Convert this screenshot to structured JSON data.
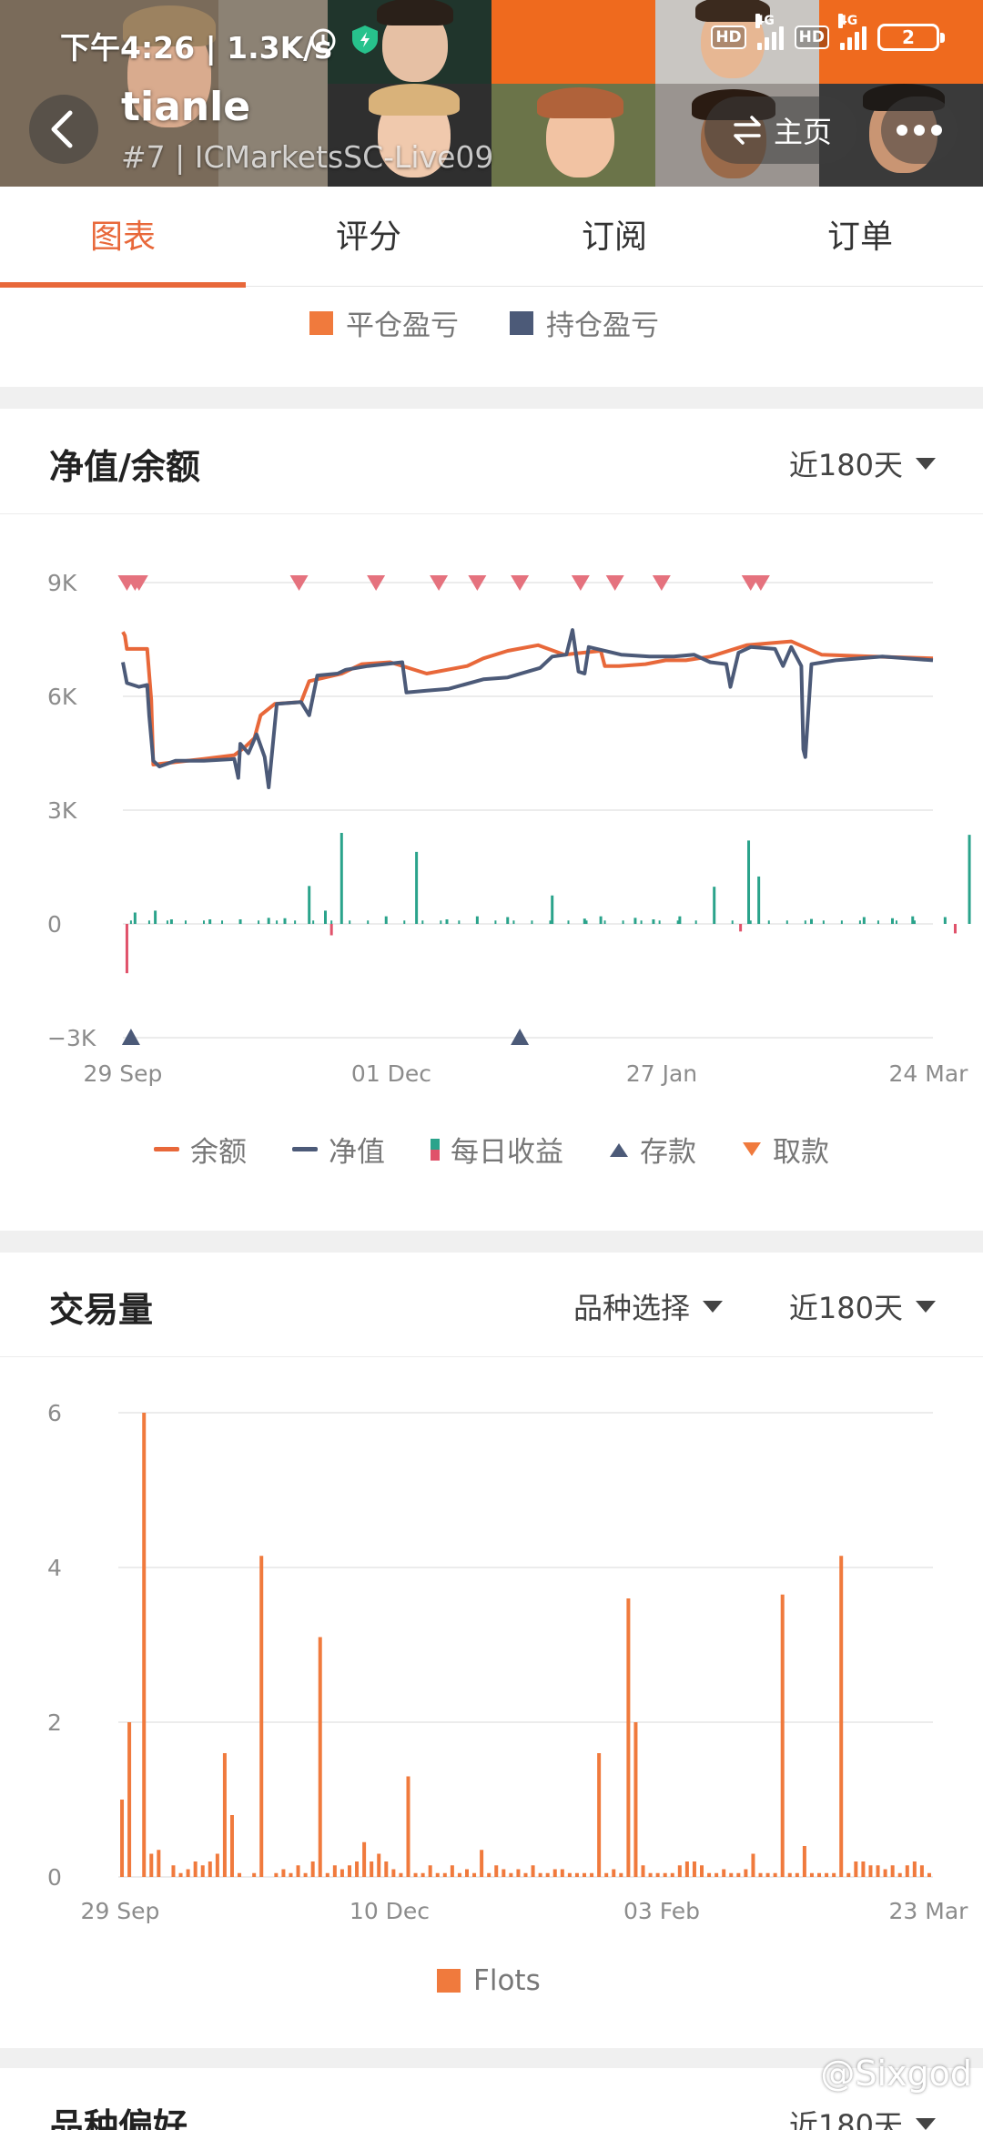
{
  "status_bar": {
    "time_speed": "下午4:26 | 1.3K/s",
    "hd1": "HD",
    "hd2": "HD",
    "net1": "4G",
    "net2": "4G",
    "battery": "2"
  },
  "header": {
    "name": "tianle",
    "subtitle": "#7 | ICMarketsSC-Live09",
    "home_label": "主页"
  },
  "tabs": [
    {
      "label": "图表"
    },
    {
      "label": "评分"
    },
    {
      "label": "订阅"
    },
    {
      "label": "订单"
    }
  ],
  "pnl_legend": {
    "closed": "平仓盈亏",
    "open": "持仓盈亏",
    "closed_color": "#f07a3d",
    "open_color": "#4c5a78"
  },
  "equity_section": {
    "title": "净值/余额",
    "range": "近180天",
    "legend": {
      "balance": "余额",
      "equity": "净值",
      "daily": "每日收益",
      "deposit": "存款",
      "withdraw": "取款"
    },
    "colors": {
      "balance": "#e8683a",
      "equity": "#4c5a78",
      "daily_pos": "#2aa38b",
      "daily_neg": "#e0526a",
      "deposit": "#4c5a78",
      "withdraw": "#e5727e"
    }
  },
  "volume_section": {
    "title": "交易量",
    "filter": "品种选择",
    "range": "近180天",
    "legend": "Flots",
    "color": "#f07a3d"
  },
  "next_section": {
    "title": "品种偏好",
    "range": "近180天"
  },
  "watermark": "@Sixgod",
  "chart_data": [
    {
      "type": "line",
      "title": "净值/余额",
      "x_ticks": [
        "29 Sep",
        "01 Dec",
        "27 Jan",
        "24 Mar"
      ],
      "y_ticks": [
        "9K",
        "6K",
        "3K",
        "0",
        "−3K"
      ],
      "ylim": [
        -3000,
        9000
      ],
      "x_days": 176,
      "series": [
        {
          "name": "余额",
          "points": [
            [
              0,
              7700
            ],
            [
              1,
              7600
            ],
            [
              2,
              7250
            ],
            [
              12,
              7250
            ],
            [
              14,
              5900
            ],
            [
              15,
              4200
            ],
            [
              40,
              4350
            ],
            [
              55,
              4450
            ],
            [
              60,
              4650
            ],
            [
              65,
              4900
            ],
            [
              68,
              5500
            ],
            [
              75,
              5800
            ],
            [
              88,
              5850
            ],
            [
              92,
              6400
            ],
            [
              108,
              6600
            ],
            [
              118,
              6850
            ],
            [
              132,
              6900
            ],
            [
              150,
              6600
            ],
            [
              170,
              6800
            ],
            [
              178,
              7000
            ],
            [
              190,
              7200
            ],
            [
              205,
              7350
            ],
            [
              218,
              7100
            ],
            [
              236,
              7200
            ],
            [
              238,
              6800
            ],
            [
              245,
              6800
            ],
            [
              258,
              6850
            ],
            [
              268,
              6950
            ],
            [
              278,
              6950
            ],
            [
              290,
              7050
            ],
            [
              308,
              7350
            ],
            [
              330,
              7450
            ],
            [
              345,
              7100
            ],
            [
              370,
              7050
            ],
            [
              400,
              7000
            ]
          ]
        },
        {
          "name": "净值",
          "points": [
            [
              0,
              6900
            ],
            [
              2,
              6350
            ],
            [
              8,
              6250
            ],
            [
              12,
              6300
            ],
            [
              13,
              5500
            ],
            [
              15,
              4300
            ],
            [
              18,
              4150
            ],
            [
              26,
              4300
            ],
            [
              40,
              4300
            ],
            [
              55,
              4350
            ],
            [
              57,
              3850
            ],
            [
              58,
              4750
            ],
            [
              62,
              4500
            ],
            [
              66,
              5000
            ],
            [
              70,
              4400
            ],
            [
              72,
              3600
            ],
            [
              76,
              5800
            ],
            [
              88,
              5850
            ],
            [
              92,
              5500
            ],
            [
              96,
              6550
            ],
            [
              106,
              6600
            ],
            [
              110,
              6700
            ],
            [
              121,
              6800
            ],
            [
              138,
              6900
            ],
            [
              140,
              6100
            ],
            [
              150,
              6150
            ],
            [
              161,
              6200
            ],
            [
              178,
              6450
            ],
            [
              190,
              6500
            ],
            [
              206,
              6750
            ],
            [
              212,
              7050
            ],
            [
              219,
              7100
            ],
            [
              222,
              7750
            ],
            [
              225,
              6650
            ],
            [
              228,
              6600
            ],
            [
              230,
              7300
            ],
            [
              246,
              7100
            ],
            [
              260,
              7050
            ],
            [
              272,
              7050
            ],
            [
              282,
              7100
            ],
            [
              290,
              6900
            ],
            [
              298,
              6850
            ],
            [
              300,
              6250
            ],
            [
              304,
              7150
            ],
            [
              310,
              7300
            ],
            [
              322,
              7250
            ],
            [
              326,
              6800
            ],
            [
              330,
              7300
            ],
            [
              335,
              6800
            ],
            [
              336,
              4600
            ],
            [
              337,
              4400
            ],
            [
              340,
              6850
            ],
            [
              352,
              6950
            ],
            [
              375,
              7050
            ],
            [
              400,
              6950
            ]
          ]
        },
        {
          "name": "每日收益",
          "days": [
            [
              2,
              -1300
            ],
            [
              6,
              300
            ],
            [
              16,
              350
            ],
            [
              24,
              120
            ],
            [
              43,
              120
            ],
            [
              58,
              120
            ],
            [
              72,
              160
            ],
            [
              80,
              150
            ],
            [
              92,
              1000
            ],
            [
              100,
              350
            ],
            [
              103,
              -300
            ],
            [
              108,
              2400
            ],
            [
              130,
              200
            ],
            [
              145,
              1900
            ],
            [
              160,
              120
            ],
            [
              175,
              200
            ],
            [
              190,
              180
            ],
            [
              212,
              750
            ],
            [
              228,
              140
            ],
            [
              236,
              200
            ],
            [
              253,
              160
            ],
            [
              262,
              120
            ],
            [
              275,
              200
            ],
            [
              292,
              980
            ],
            [
              305,
              -200
            ],
            [
              309,
              2200
            ],
            [
              314,
              1250
            ],
            [
              340,
              130
            ],
            [
              366,
              180
            ],
            [
              380,
              150
            ],
            [
              390,
              200
            ],
            [
              406,
              180
            ],
            [
              411,
              -250
            ],
            [
              418,
              2350
            ],
            [
              427,
              250
            ],
            [
              439,
              -200
            ],
            [
              447,
              2600
            ],
            [
              455,
              150
            ],
            [
              460,
              120
            ],
            [
              475,
              130
            ]
          ]
        },
        {
          "name": "存款",
          "points": [
            [
              4,
              -3000
            ],
            [
              196,
              -3000
            ]
          ]
        },
        {
          "name": "取款",
          "points": [
            [
              2,
              9000
            ],
            [
              6,
              9000
            ],
            [
              8,
              9000
            ],
            [
              87,
              9000
            ],
            [
              125,
              9000
            ],
            [
              156,
              9000
            ],
            [
              175,
              9000
            ],
            [
              196,
              9000
            ],
            [
              226,
              9000
            ],
            [
              243,
              9000
            ],
            [
              266,
              9000
            ],
            [
              310,
              9000
            ],
            [
              315,
              9000
            ]
          ]
        }
      ]
    },
    {
      "type": "bar",
      "title": "交易量",
      "x_ticks": [
        "29 Sep",
        "10 Dec",
        "03 Feb",
        "23 Mar"
      ],
      "y_ticks": [
        "6",
        "4",
        "2",
        "0"
      ],
      "ylim": [
        0,
        6
      ],
      "series": [
        {
          "name": "Flots",
          "values": [
            1.0,
            2.0,
            0.0,
            6.0,
            0.3,
            0.35,
            0.0,
            0.15,
            0.05,
            0.1,
            0.2,
            0.15,
            0.2,
            0.3,
            1.6,
            0.8,
            0.05,
            0.0,
            0.05,
            4.15,
            0.0,
            0.05,
            0.1,
            0.05,
            0.15,
            0.05,
            0.2,
            3.1,
            0.05,
            0.15,
            0.1,
            0.15,
            0.2,
            0.45,
            0.2,
            0.3,
            0.2,
            0.1,
            0.05,
            1.3,
            0.05,
            0.05,
            0.15,
            0.05,
            0.05,
            0.15,
            0.05,
            0.1,
            0.05,
            0.35,
            0.05,
            0.15,
            0.1,
            0.05,
            0.1,
            0.05,
            0.15,
            0.05,
            0.05,
            0.1,
            0.1,
            0.05,
            0.05,
            0.05,
            0.05,
            1.6,
            0.05,
            0.1,
            0.05,
            3.6,
            2.0,
            0.15,
            0.05,
            0.05,
            0.05,
            0.05,
            0.15,
            0.2,
            0.2,
            0.15,
            0.05,
            0.05,
            0.1,
            0.05,
            0.05,
            0.1,
            0.3,
            0.05,
            0.05,
            0.05,
            3.65,
            0.05,
            0.05,
            0.4,
            0.05,
            0.05,
            0.05,
            0.05,
            4.15,
            0.05,
            0.2,
            0.2,
            0.15,
            0.15,
            0.1,
            0.15,
            0.05,
            0.15,
            0.2,
            0.15,
            0.05
          ]
        }
      ]
    }
  ]
}
